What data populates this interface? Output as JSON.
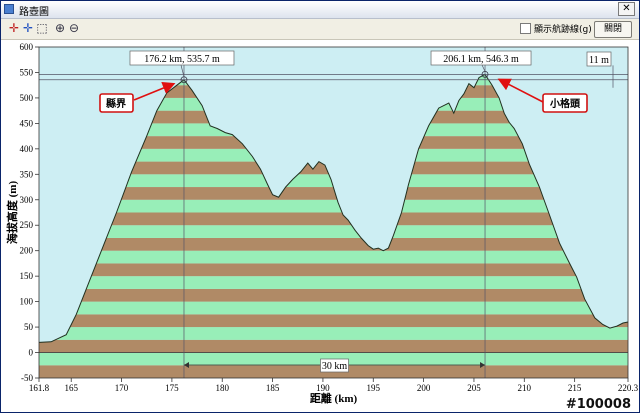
{
  "window": {
    "title": "路壺圖",
    "close_glyph": "✕"
  },
  "toolbar": {
    "tools": [
      {
        "icon": "crosshair-red-icon",
        "glyph": "✛",
        "color": "#c02020"
      },
      {
        "icon": "crosshair-blue-icon",
        "glyph": "✛",
        "color": "#2050c0"
      },
      {
        "icon": "select-tool-icon",
        "glyph": "⬚",
        "color": "#334455"
      },
      {
        "icon": "zoom-in-icon",
        "glyph": "⊕",
        "color": "#334455"
      },
      {
        "icon": "zoom-out-icon",
        "glyph": "⊖",
        "color": "#334455"
      }
    ],
    "checkbox_label": "顯示航跡線(g)",
    "checkbox_checked": false,
    "close_label": "關閉"
  },
  "watermark": "#100008",
  "chart_data": {
    "type": "area",
    "xlabel": "距離 (km)",
    "ylabel": "海拔高度 (m)",
    "xlim": [
      161.8,
      220.3
    ],
    "ylim": [
      -50,
      600
    ],
    "x_ticks": [
      161.8,
      165,
      170,
      175,
      180,
      185,
      190,
      195,
      200,
      205,
      210,
      215,
      220.3
    ],
    "y_ticks": [
      -50,
      0,
      50,
      100,
      150,
      200,
      250,
      300,
      350,
      400,
      450,
      500,
      550,
      600
    ],
    "grid": false,
    "band_colors": [
      "#b08a66",
      "#98eeb8"
    ],
    "background_color": "#cdeef3",
    "series": [
      {
        "x": [
          161.8,
          163,
          164.5,
          165.5,
          166.5,
          168,
          169.5,
          171,
          172.5,
          173.5,
          174.5,
          175.5,
          176.2,
          177,
          178,
          178.8,
          179.5,
          180.3,
          181,
          182,
          183,
          183.8,
          184.5,
          185,
          185.6,
          186.3,
          187,
          187.8,
          188.5,
          189,
          189.6,
          190.2,
          190.8,
          191.5,
          192,
          192.5,
          193.2,
          193.8,
          194.5,
          195,
          195.5,
          196,
          196.5,
          197,
          197.8,
          198.5,
          199.5,
          200.5,
          201.5,
          202.5,
          203,
          203.5,
          204,
          204.5,
          205,
          205.5,
          206.1,
          206.8,
          207.5,
          208,
          208.5,
          209,
          209.8,
          210.5,
          211.5,
          212.5,
          213.5,
          214.5,
          215.2,
          216,
          217,
          217.8,
          218.5,
          219.2,
          219.8,
          220.3
        ],
        "y": [
          20,
          21,
          35,
          75,
          125,
          200,
          275,
          355,
          425,
          475,
          510,
          525,
          535.7,
          515,
          485,
          445,
          440,
          432,
          428,
          410,
          385,
          360,
          330,
          310,
          305,
          325,
          340,
          355,
          372,
          360,
          375,
          368,
          340,
          295,
          270,
          260,
          240,
          225,
          210,
          203,
          205,
          200,
          205,
          230,
          275,
          330,
          400,
          445,
          480,
          490,
          470,
          495,
          508,
          528,
          520,
          540,
          546.3,
          525,
          500,
          470,
          452,
          440,
          410,
          370,
          325,
          270,
          215,
          175,
          148,
          105,
          68,
          55,
          48,
          52,
          58,
          60
        ]
      }
    ],
    "annotations": [
      {
        "text": "176.2 km, 535.7 m",
        "x": 176.2,
        "y": 535.7
      },
      {
        "text": "206.1 km, 546.3 m",
        "x": 206.1,
        "y": 546.3
      },
      {
        "text": "11 m"
      },
      {
        "text": "30 km"
      }
    ],
    "callouts": [
      {
        "text": "縣界",
        "points_to_x": 176.2,
        "points_to_y": 535.7
      },
      {
        "text": "小格頭",
        "points_to_x": 206.1,
        "points_to_y": 546.3
      }
    ],
    "reference_lines": {
      "y_lines": [
        535.7,
        546.3
      ],
      "x_lines": [
        176.2,
        206.1
      ]
    }
  }
}
